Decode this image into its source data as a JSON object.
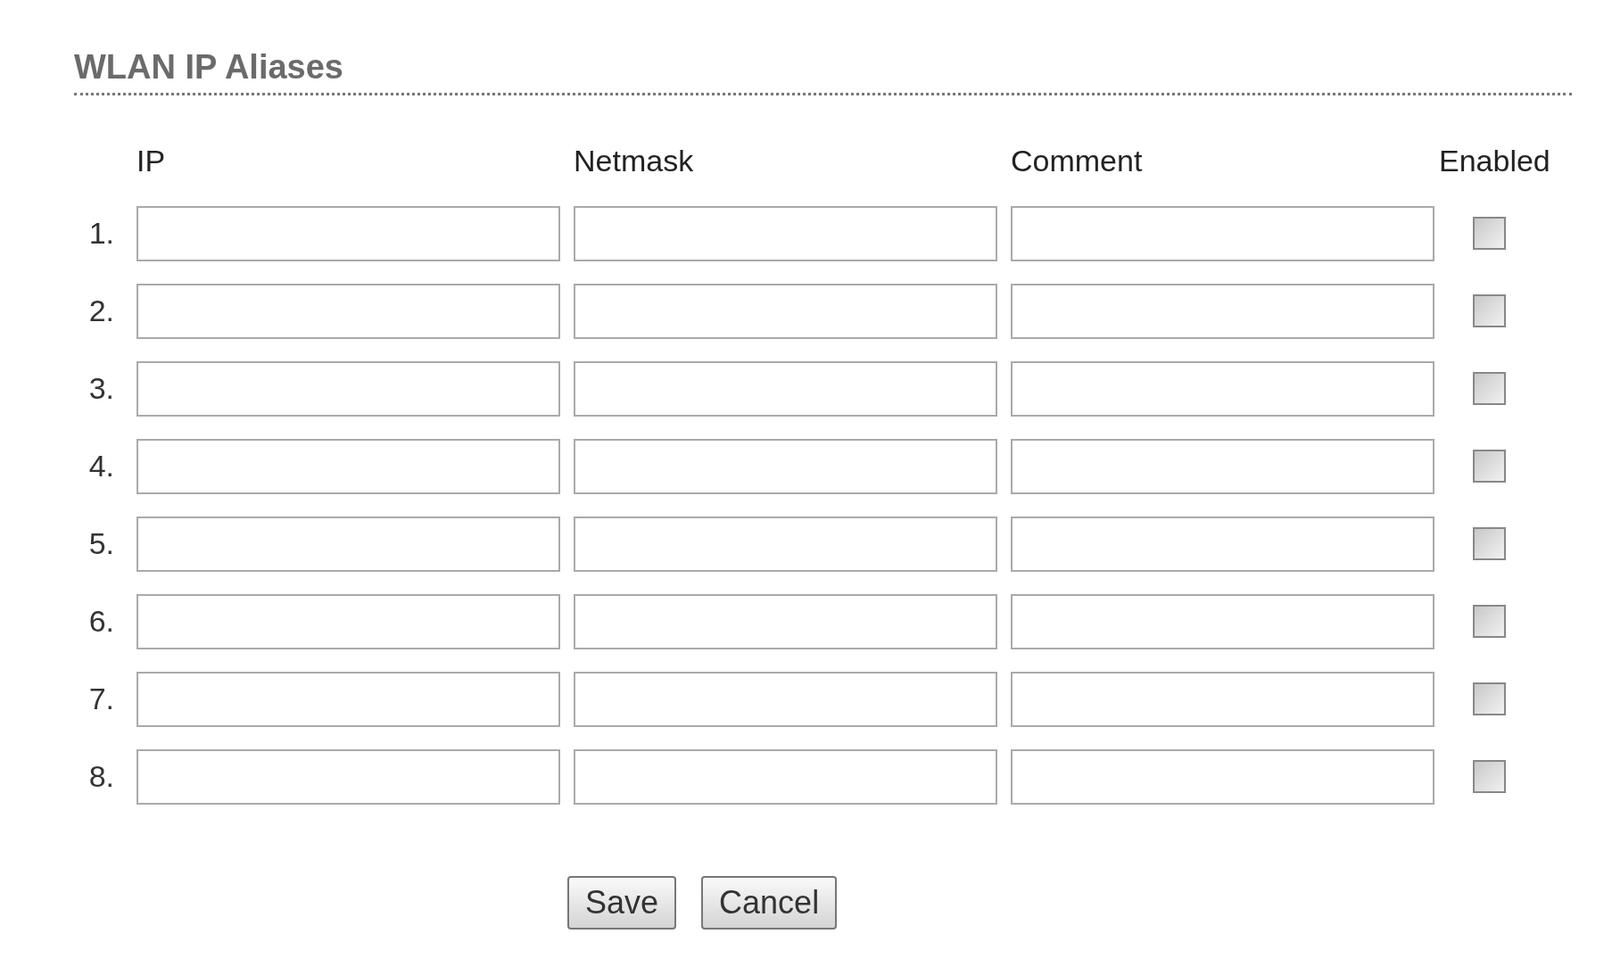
{
  "title": "WLAN IP Aliases",
  "columns": [
    "IP",
    "Netmask",
    "Comment",
    "Enabled"
  ],
  "rows": [
    {
      "number": "1.",
      "enabled": false
    },
    {
      "number": "2.",
      "enabled": false
    },
    {
      "number": "3.",
      "enabled": false
    },
    {
      "number": "4.",
      "enabled": false
    },
    {
      "number": "5.",
      "enabled": false
    },
    {
      "number": "6.",
      "enabled": false
    },
    {
      "number": "7.",
      "enabled": false
    },
    {
      "number": "8.",
      "enabled": false
    }
  ],
  "buttons": [
    "Save",
    "Cancel"
  ]
}
